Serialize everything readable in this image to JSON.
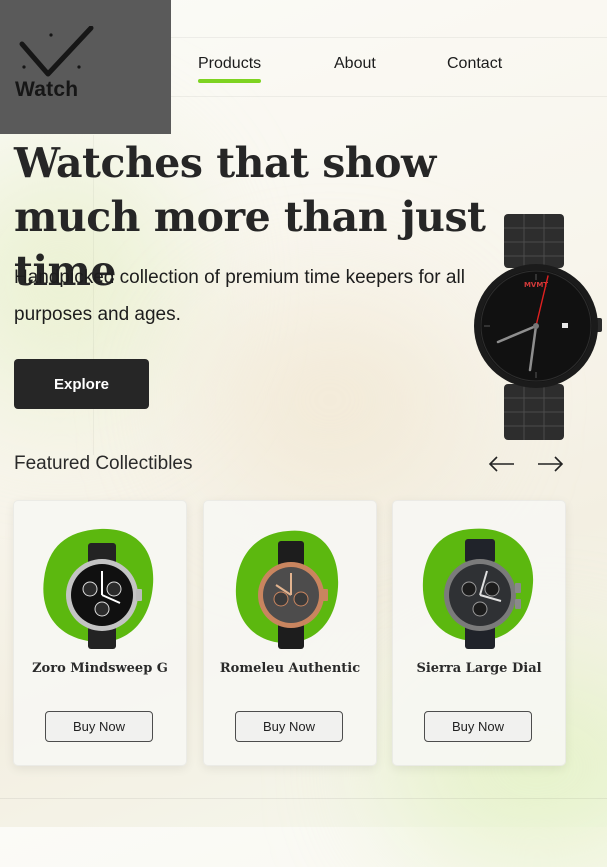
{
  "brand": {
    "name": "Watch",
    "logo_icon": "watch-check-icon"
  },
  "nav": {
    "items": [
      {
        "label": "Products",
        "active": true
      },
      {
        "label": "About"
      },
      {
        "label": "Contact"
      }
    ]
  },
  "hero": {
    "title": "Watches that show much more than just time",
    "subtitle": "Handpicked collection of premium time keepers for all purposes and ages.",
    "cta_label": "Explore",
    "watch_brand": "MVMT"
  },
  "featured": {
    "title": "Featured Collectibles",
    "prev_icon": "arrow-left-icon",
    "next_icon": "arrow-right-icon",
    "products": [
      {
        "name": "Zoro Mindsweep G",
        "button": "Buy Now"
      },
      {
        "name": "Romeleu Authentic",
        "button": "Buy Now"
      },
      {
        "name": "Sierra Large Dial",
        "button": "Buy Now"
      }
    ]
  },
  "colors": {
    "accent": "#7ed321",
    "blob": "#5cb80f",
    "dark": "#262626",
    "logo_bg": "#5a5a5a"
  }
}
